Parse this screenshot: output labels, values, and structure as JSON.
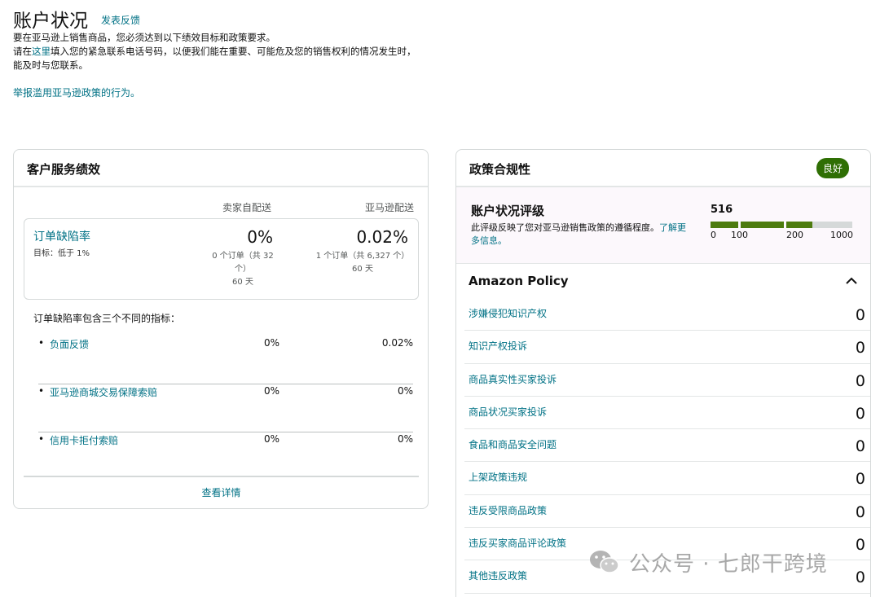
{
  "header": {
    "title": "账户状况",
    "feedback_link": "发表反馈",
    "intro_line1": "要在亚马逊上销售商品，您必须达到以下绩效目标和政策要求。",
    "intro_line2_prefix": "请在",
    "intro_line2_link": "这里",
    "intro_line2_suffix": "填入您的紧急联系电话号码，以便我们能在重要、可能危及您的销售权利的情况发生时，能及时与您联系。",
    "report_link": "举报滥用亚马逊政策的行为。"
  },
  "customer_service": {
    "title": "客户服务绩效",
    "col_seller": "卖家自配送",
    "col_amazon": "亚马逊配送",
    "odr": {
      "label": "订单缺陷率",
      "target": "目标：低于 1%",
      "seller_value": "0%",
      "seller_sub": "0 个订单（共 32 个）",
      "seller_days": "60 天",
      "amazon_value": "0.02%",
      "amazon_sub": "1 个订单（共 6,327 个）",
      "amazon_days": "60 天"
    },
    "metrics_intro": "订单缺陷率包含三个不同的指标：",
    "metrics": [
      {
        "label": "负面反馈",
        "seller": "0%",
        "amazon": "0.02%"
      },
      {
        "label": "亚马逊商城交易保障索赔",
        "seller": "0%",
        "amazon": "0%"
      },
      {
        "label": "信用卡拒付索赔",
        "seller": "0%",
        "amazon": "0%"
      }
    ],
    "details_link": "查看详情"
  },
  "policy_compliance": {
    "title": "政策合规性",
    "badge": "良好",
    "rating_title": "账户状况评级",
    "rating_desc": "此评级反映了您对亚马逊销售政策的遵循程度。",
    "rating_link": "了解更多信息。",
    "score": "516",
    "score_value": 516,
    "scale": [
      "0",
      "100",
      "200",
      "1000"
    ],
    "bar_colors": {
      "filled": "#4d7b0f",
      "empty": "#d5d9d9"
    },
    "section_title": "Amazon Policy",
    "items": [
      {
        "label": "涉嫌侵犯知识产权",
        "count": "0"
      },
      {
        "label": "知识产权投诉",
        "count": "0"
      },
      {
        "label": "商品真实性买家投诉",
        "count": "0"
      },
      {
        "label": "商品状况买家投诉",
        "count": "0"
      },
      {
        "label": "食品和商品安全问题",
        "count": "0"
      },
      {
        "label": "上架政策违规",
        "count": "0"
      },
      {
        "label": "违反受限商品政策",
        "count": "0"
      },
      {
        "label": "违反买家商品评论政策",
        "count": "0"
      },
      {
        "label": "其他违反政策",
        "count": "0"
      }
    ]
  },
  "watermark": {
    "text": "公众号 · 七郎干跨境",
    "icon": "wechat-icon"
  }
}
